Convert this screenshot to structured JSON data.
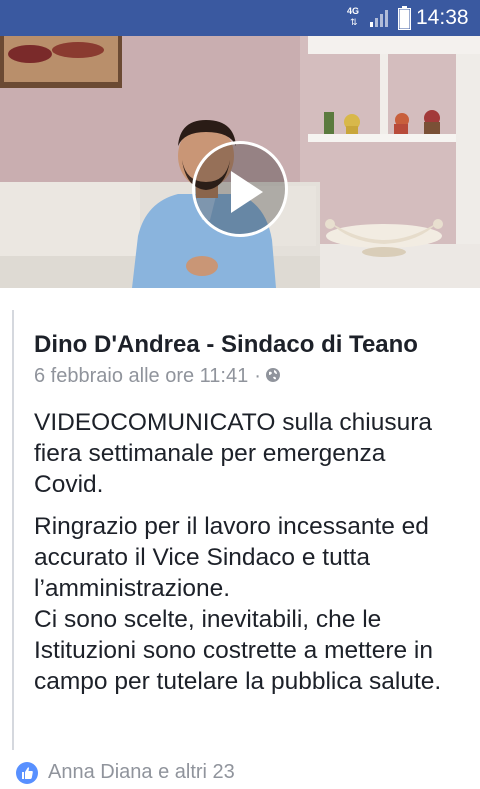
{
  "status_bar": {
    "network_label": "4G",
    "time": "14:38",
    "signal_icon": "signal-bars-icon",
    "battery_icon": "battery-icon"
  },
  "video": {
    "play_icon": "play-icon"
  },
  "post": {
    "author": "Dino D'Andrea - Sindaco di Teano",
    "timestamp": "6 febbraio alle ore 11:41",
    "separator": "·",
    "privacy_icon": "globe-icon",
    "paragraph1": "VIDEOCOMUNICATO sulla chiusura fiera settimanale per emergenza Covid.",
    "paragraph2_line1": "Ringrazio per il lavoro incessante ed accurato il Vice Sindaco e tutta l’amministrazione.",
    "paragraph2_line2": "Ci sono scelte, inevitabili, che le Istituzioni sono costrette a mettere in campo per tutelare la pubblica salute."
  },
  "reactions": {
    "icon": "like-icon",
    "text": "Anna Diana e altri 23"
  },
  "colors": {
    "status_bar": "#3a59a0",
    "author_text": "#1d2129",
    "meta_text": "#90949c",
    "like_blue": "#5890ff"
  }
}
